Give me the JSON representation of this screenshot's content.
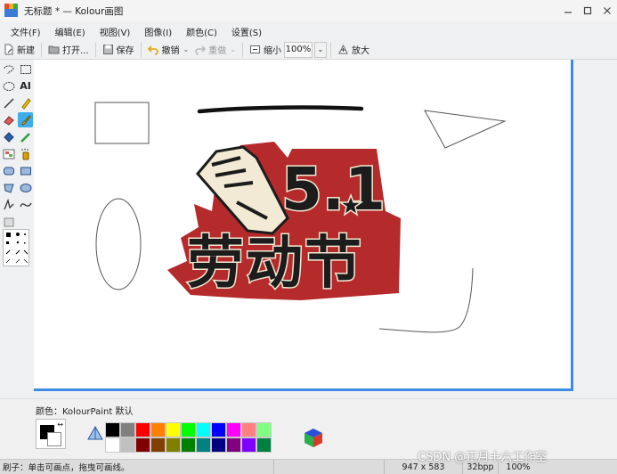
{
  "window": {
    "title": "无标题 * — Kolour画图",
    "controls": [
      "minimize-icon",
      "maximize-icon",
      "close-icon"
    ]
  },
  "menu": [
    "文件(F)",
    "编辑(E)",
    "视图(V)",
    "图像(I)",
    "颜色(C)",
    "设置(S)"
  ],
  "toolbar": {
    "new_label": "新建",
    "open_label": "打开...",
    "save_label": "保存",
    "undo_label": "撤销",
    "redo_label": "重做",
    "zoom_out_label": "缩小",
    "zoom_value": "100%",
    "zoom_in_label": "放大"
  },
  "tools": [
    "freeform-select-icon",
    "rect-select-icon",
    "ellipse-select-icon",
    "text-tool-icon",
    "line-tool-icon",
    "pen-tool-icon",
    "eraser-tool-icon",
    "brush-tool-icon",
    "fill-tool-icon",
    "color-picker-icon",
    "zoom-tool-icon",
    "spraycan-icon",
    "rounded-rect-tool-icon",
    "rect-tool-icon",
    "polygon-tool-icon",
    "ellipse-tool-icon",
    "polyline-tool-icon",
    "curve-tool-icon",
    "stamp-tool-icon"
  ],
  "canvas": {
    "badge_number": "5.1",
    "badge_text": "劳动节"
  },
  "palette": {
    "label": "颜色：KolourPaint 默认",
    "colors_top": [
      "#000000",
      "#808080",
      "#ff0000",
      "#ff8000",
      "#ffff00",
      "#00ff00",
      "#00ffff",
      "#0000ff",
      "#ff00ff",
      "#ff8080",
      "#80ff80"
    ],
    "colors_bottom": [
      "#ffffff",
      "#c0c0c0",
      "#800000",
      "#804000",
      "#808000",
      "#008000",
      "#008080",
      "#000080",
      "#800080",
      "#8000ff",
      "#008040"
    ]
  },
  "status": {
    "message": "刷子：单击可画点，拖曳可画线。",
    "size": "947 x 583",
    "depth": "32bpp",
    "zoom": "100%"
  },
  "watermark": "CSDN @正月十六工作室"
}
